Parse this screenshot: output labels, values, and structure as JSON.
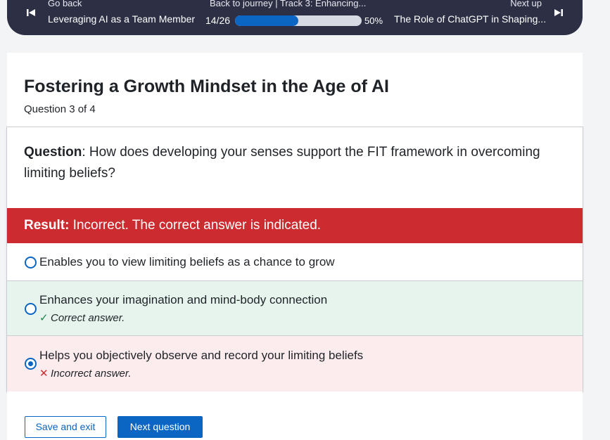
{
  "nav": {
    "go_back_label": "Go back",
    "prev_title": "Leveraging AI as a Team Member",
    "journey_label": "Back to journey  |  Track 3: Enhancing...",
    "progress_count": "14/26",
    "progress_fraction": 0.5,
    "progress_percent": "50%",
    "next_label": "Next up",
    "next_title": "The Role of ChatGPT in Shaping...",
    "prev_icon": "skip-previous-icon",
    "next_icon": "skip-next-icon"
  },
  "header": {
    "title": "Fostering a Growth Mindset in the Age of AI",
    "counter": "Question 3 of 4"
  },
  "question": {
    "prefix": "Question",
    "text": ": How does developing your senses support the FIT framework in overcoming limiting beliefs?"
  },
  "result": {
    "prefix": "Result:",
    "text": " Incorrect. The correct answer is indicated."
  },
  "options": [
    {
      "label": "Enables you to view limiting beliefs as a chance to grow",
      "selected": false,
      "feedback": ""
    },
    {
      "label": "Enhances your imagination and mind-body connection",
      "selected": false,
      "feedback": "Correct answer."
    },
    {
      "label": "Helps you objectively observe and record your limiting beliefs",
      "selected": true,
      "feedback": "Incorrect answer."
    }
  ],
  "footer": {
    "save_label": "Save and exit",
    "next_label": "Next question"
  },
  "colors": {
    "accent": "#0a66c2",
    "nav_bg": "#2d2f45",
    "error": "#cc2b2f",
    "correct_bg": "#e7f4ee",
    "incorrect_bg": "#fdecee"
  }
}
